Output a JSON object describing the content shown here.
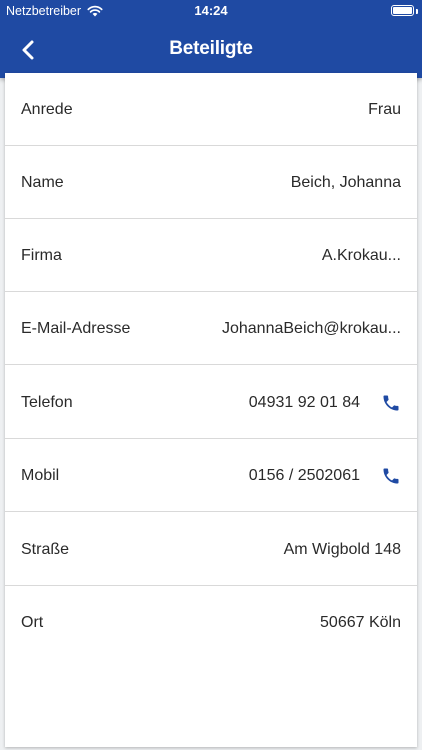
{
  "status_bar": {
    "carrier": "Netzbetreiber",
    "time": "14:24",
    "wifi_icon": "wifi-icon",
    "battery_icon": "battery-icon"
  },
  "nav": {
    "back_icon": "chevron-left-icon",
    "title": "Beteiligte"
  },
  "colors": {
    "header_bg": "#1f4aa3",
    "accent": "#1f4aa3",
    "card_bg": "#ffffff",
    "page_bg": "#eef0f2"
  },
  "details": {
    "anrede": {
      "label": "Anrede",
      "value": "Frau"
    },
    "name": {
      "label": "Name",
      "value": "Beich, Johanna"
    },
    "firma": {
      "label": "Firma",
      "value": "A.Krokau..."
    },
    "email": {
      "label": "E-Mail-Adresse",
      "value": "JohannaBeich@krokau..."
    },
    "telefon": {
      "label": "Telefon",
      "value": "04931 92 01 84",
      "icon": "phone-icon"
    },
    "mobil": {
      "label": "Mobil",
      "value": "0156 / 2502061",
      "icon": "phone-icon"
    },
    "strasse": {
      "label": "Straße",
      "value": "Am Wigbold 148"
    },
    "ort": {
      "label": "Ort",
      "value": "50667 Köln"
    }
  }
}
